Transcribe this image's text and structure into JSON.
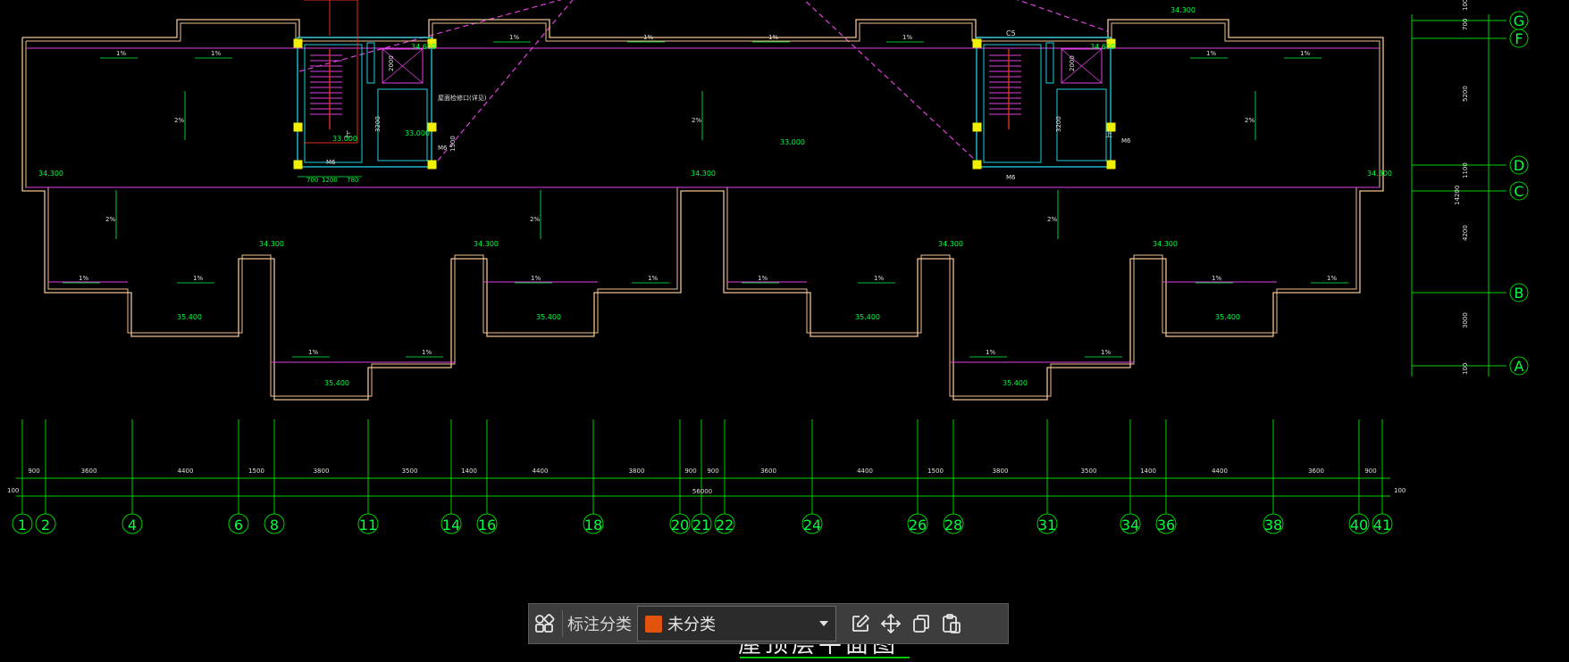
{
  "toolbar": {
    "category_label": "标注分类",
    "category_value": "未分类",
    "category_color": "#e2540e",
    "icons": [
      "grid-icon",
      "edit-icon",
      "move-icon",
      "copy-icon",
      "paste-icon"
    ]
  },
  "drawing": {
    "title": "屋顶层平面图",
    "colors": {
      "wall": "#f0c090",
      "grid": "#00d000",
      "text": "#00ff40",
      "magenta": "#e040e0",
      "cyan": "#20d0e0",
      "yellow": "#f0f000",
      "white": "#e0e0e0",
      "red": "#e03020"
    },
    "row_axes": [
      "G",
      "F",
      "D",
      "C",
      "B",
      "A"
    ],
    "row_dims": [
      "100",
      "700",
      "5200",
      "1100",
      "4200",
      "3000",
      "100",
      "14200"
    ],
    "col_axes": [
      "1",
      "2",
      "4",
      "6",
      "8",
      "11",
      "14",
      "16",
      "18",
      "20",
      "21",
      "22",
      "24",
      "26",
      "28",
      "31",
      "34",
      "36",
      "38",
      "40",
      "41"
    ],
    "col_dims": [
      "900",
      "3600",
      "4400",
      "1500",
      "3800",
      "3500",
      "1400",
      "4400",
      "3800",
      "900",
      "900",
      "3600",
      "4400",
      "1500",
      "3800",
      "3500",
      "1400",
      "4400",
      "3600",
      "900"
    ],
    "total_dim": "56000",
    "end_dim_left": "100",
    "end_dim_right": "100",
    "elevations": {
      "e34300": "34.300",
      "e34600": "34.600",
      "e33000": "33.000",
      "e35400": "35.400"
    },
    "slopes": {
      "s1": "1%",
      "s2": "2%"
    },
    "stair_dims": {
      "d700": "700",
      "d1200": "1200",
      "d780": "780",
      "d2000": "2000",
      "d3200": "3200",
      "d1500": "1500",
      "d5000": "1500"
    },
    "labels": {
      "c5": "C5",
      "vent": "屋面检修口(详见)",
      "m6": "M6",
      "up": "上"
    }
  }
}
